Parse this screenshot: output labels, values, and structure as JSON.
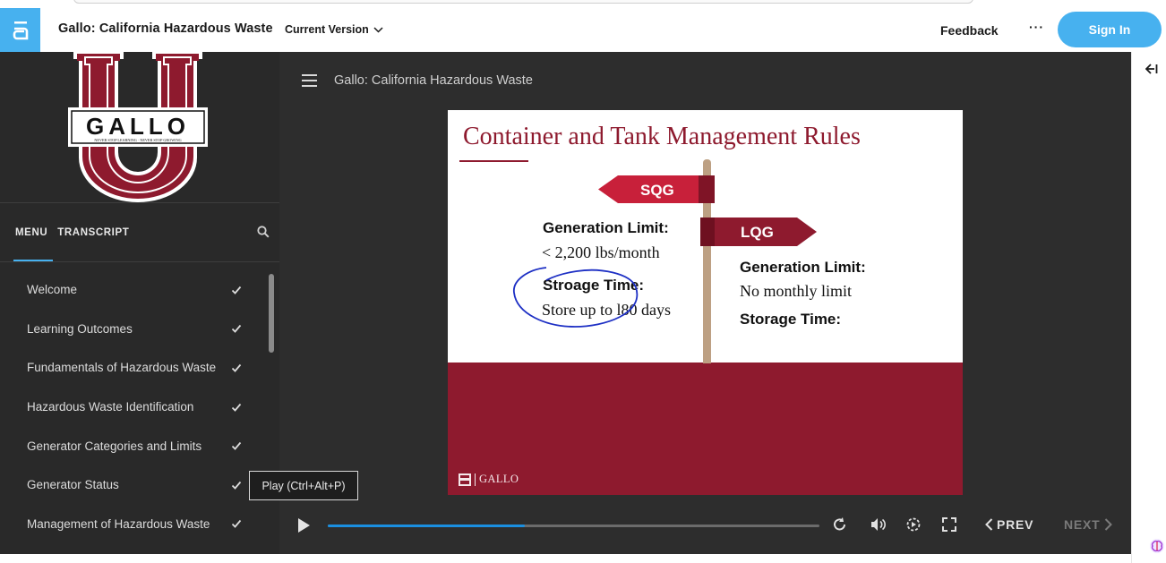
{
  "header": {
    "course_title": "Gallo: California Hazardous Waste",
    "version_label": "Current Version",
    "feedback_label": "Feedback",
    "more_label": "···",
    "signin_label": "Sign In"
  },
  "sidebar": {
    "tabs": [
      {
        "label": "MENU",
        "active": true
      },
      {
        "label": "TRANSCRIPT",
        "active": false
      }
    ],
    "items": [
      {
        "label": "Welcome",
        "completed": true
      },
      {
        "label": "Learning Outcomes",
        "completed": true
      },
      {
        "label": "Fundamentals of Hazardous Waste",
        "completed": true
      },
      {
        "label": "Hazardous Waste Identification",
        "completed": true
      },
      {
        "label": "Generator Categories and Limits",
        "completed": true
      },
      {
        "label": "Generator Status",
        "completed": true
      },
      {
        "label": "Management of Hazardous Waste",
        "completed": true
      }
    ],
    "logo": {
      "word": "GALLO",
      "tagline": "NEVER STOP LEARNING · NEVER STOP GROWING"
    }
  },
  "main": {
    "title": "Gallo: California Hazardous Waste",
    "slide": {
      "title": "Container and Tank Management Rules",
      "sqg": {
        "sign": "SQG",
        "gen_heading": "Generation Limit:",
        "gen_value": "< 2,200 lbs/month",
        "storage_heading": "Stroage Time:",
        "storage_value": "Store up to l80 days"
      },
      "lqg": {
        "sign": "LQG",
        "gen_heading": "Generation Limit:",
        "gen_value": "No monthly limit",
        "storage_heading": "Storage Time:"
      },
      "brand": "GALLO"
    },
    "tooltip": "Play (Ctrl+Alt+P)",
    "controls": {
      "prev_label": "PREV",
      "next_label": "NEXT",
      "progress": 0.4
    }
  },
  "colors": {
    "accent": "#47b1ef",
    "brand_maroon": "#8e1a2e",
    "progress": "#1a8fe0"
  }
}
